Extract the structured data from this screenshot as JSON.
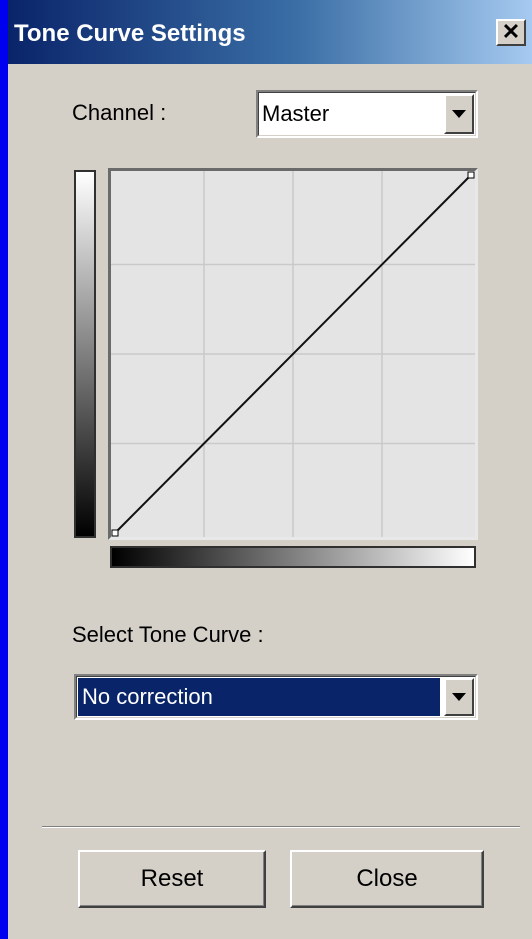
{
  "window": {
    "title": "Tone Curve Settings",
    "close_glyph": "✕"
  },
  "channel": {
    "label": "Channel :",
    "selected": "Master"
  },
  "curve_graph": {
    "grid_divisions": 4,
    "curve_points": [
      [
        0,
        0
      ],
      [
        1,
        1
      ]
    ]
  },
  "tone_curve": {
    "label": "Select Tone Curve :",
    "selected": "No correction"
  },
  "buttons": {
    "reset": "Reset",
    "close": "Close"
  },
  "colors": {
    "selection": "#0a246a",
    "face": "#d4d0c8",
    "backdrop": "#0000f0"
  }
}
